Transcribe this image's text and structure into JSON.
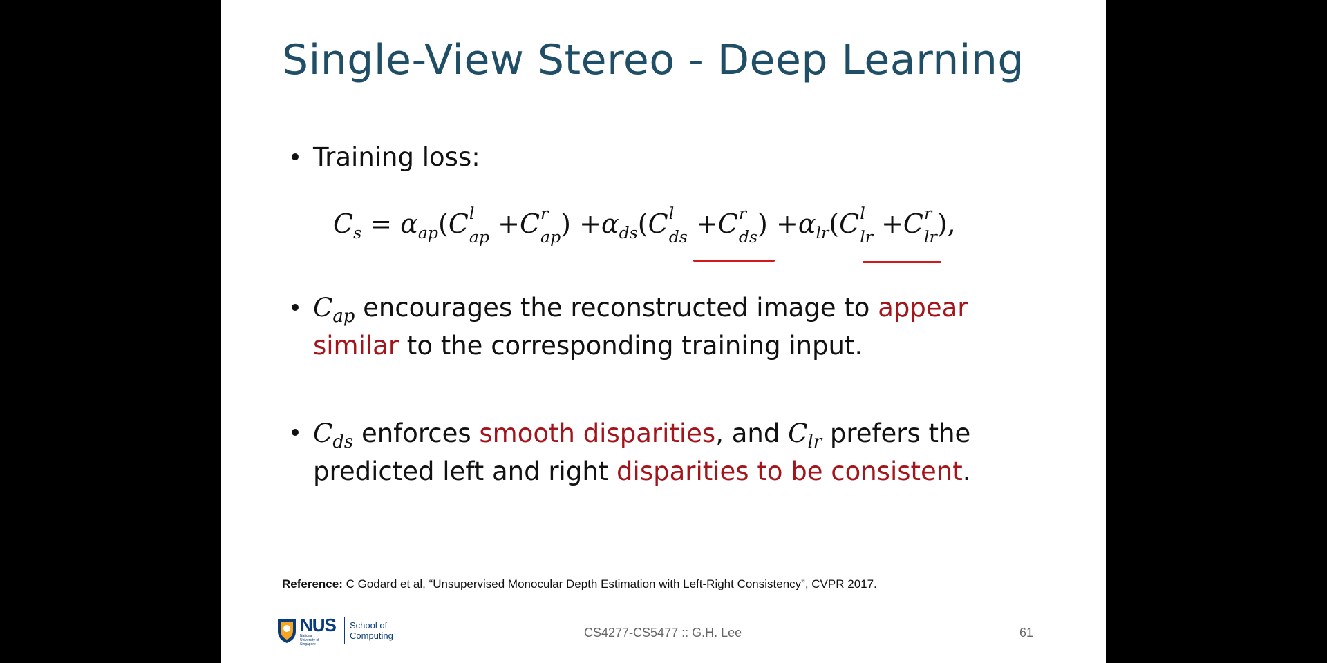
{
  "slide": {
    "title": "Single-View Stereo - Deep Learning",
    "bullet1": {
      "text": "Training loss:"
    },
    "formula": {
      "lhs": "C",
      "lhs_sub": "s",
      "eq": "=",
      "alpha": "α",
      "plus": "+",
      "lparen": "(",
      "rparen": ")",
      "comma": ",",
      "sup_l": "l",
      "sup_r": "r",
      "sub_ap": "ap",
      "sub_ds": "ds",
      "sub_lr": "lr",
      "underline_color": "#d11a1a"
    },
    "bullet2": {
      "symbol": "C",
      "symbol_sub": "ap",
      "text_a": " encourages the reconstructed image to ",
      "highlight_a": "appear",
      "highlight_b": "similar",
      "text_b": " to the corresponding training input."
    },
    "bullet3": {
      "symbol1": "C",
      "symbol1_sub": "ds",
      "text_a": " enforces ",
      "highlight_a": "smooth disparities",
      "text_b": ", and ",
      "symbol2": "C",
      "symbol2_sub": "lr",
      "text_c": " prefers the",
      "text_d": "predicted left and right ",
      "highlight_b": "disparities to be consistent",
      "text_e": "."
    },
    "reference": {
      "label": "Reference:",
      "text": " C Godard et al, “Unsupervised Monocular Depth Estimation with Left-Right Consistency”, CVPR 2017."
    },
    "footer": {
      "course": "CS4277-CS5477 :: G.H. Lee",
      "page_number": "61",
      "logo_text": "NUS",
      "logo_small": "National University of Singapore",
      "school_line1": "School of",
      "school_line2": "Computing"
    },
    "colors": {
      "title": "#1f4e66",
      "highlight": "#a3151b",
      "logo": "#0a3c7d"
    }
  }
}
